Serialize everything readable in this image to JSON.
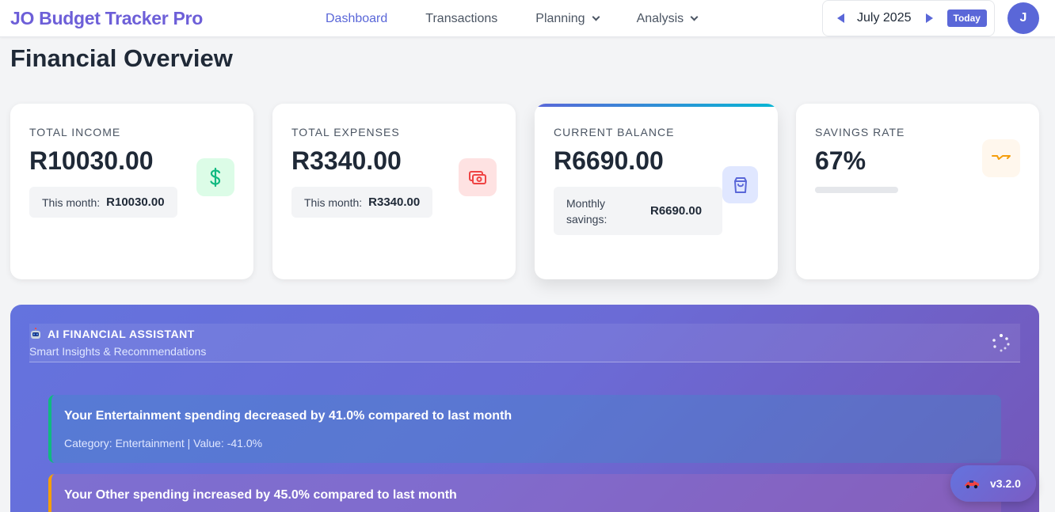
{
  "app": {
    "title": "JO Budget Tracker Pro",
    "brand_color": "#6d5fd8",
    "accent": "#5a67d8"
  },
  "nav": {
    "items": [
      {
        "label": "Dashboard",
        "active": true
      },
      {
        "label": "Transactions"
      },
      {
        "label": "Planning",
        "dropdown": true
      },
      {
        "label": "Analysis",
        "dropdown": true
      }
    ]
  },
  "period": {
    "label": "July 2025",
    "today_label": "Today"
  },
  "user": {
    "initial": "J"
  },
  "page": {
    "title": "Financial Overview"
  },
  "cards": {
    "income": {
      "label": "TOTAL INCOME",
      "value": "R10030.00",
      "sub_label": "This month:",
      "sub_value": "R10030.00",
      "icon": "dollar-icon",
      "color": "#10b981"
    },
    "expenses": {
      "label": "TOTAL EXPENSES",
      "value": "R3340.00",
      "sub_label": "This month:",
      "sub_value": "R3340.00",
      "icon": "money-icon",
      "color": "#ef4444"
    },
    "balance": {
      "label": "CURRENT BALANCE",
      "value": "R6690.00",
      "sub_label": "Monthly savings:",
      "sub_value": "R6690.00",
      "icon": "shopping-bag-icon",
      "color": "#5a67d8"
    },
    "savings": {
      "label": "SAVINGS RATE",
      "value": "67%",
      "icon": "trend-icon",
      "color": "#f59e0b"
    }
  },
  "ai": {
    "title": "AI FINANCIAL ASSISTANT",
    "subtitle": "Smart Insights & Recommendations",
    "insights": [
      {
        "title": "Your Entertainment spending decreased by 41.0% compared to last month",
        "meta": "Category: Entertainment | Value: -41.0%",
        "tone": "positive"
      },
      {
        "title": "Your Other spending increased by 45.0% compared to last month",
        "tone": "warning"
      }
    ]
  },
  "version": {
    "label": "v3.2.0"
  }
}
